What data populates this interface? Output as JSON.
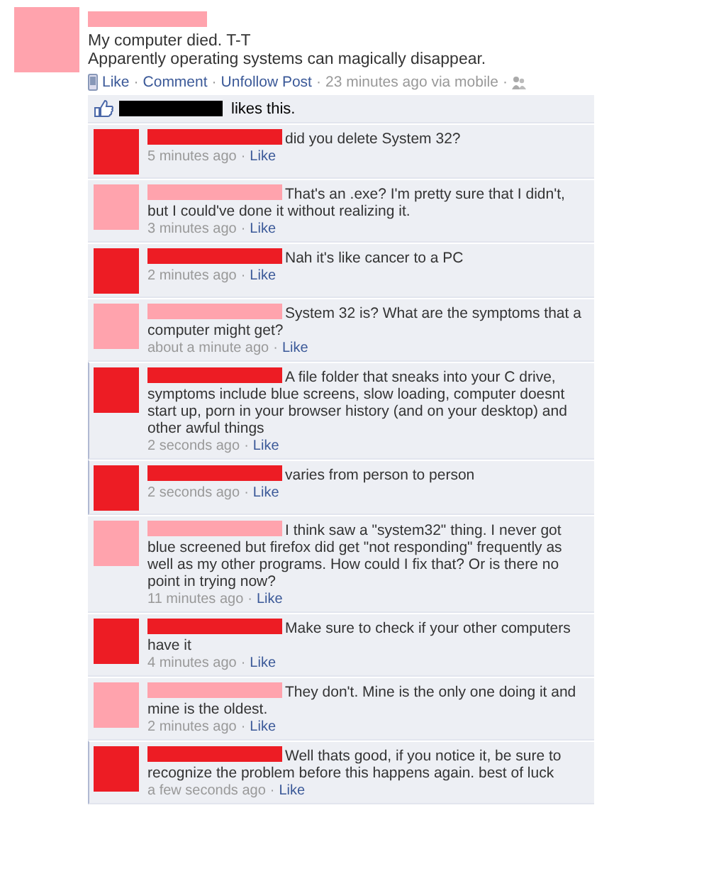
{
  "post": {
    "color": "#ffa3ad",
    "lines": [
      "My computer died. T-T",
      "Apparently operating systems can magically disappear."
    ],
    "actions": [
      "Like",
      "Comment",
      "Unfollow Post"
    ],
    "time": "23 minutes ago via mobile",
    "separator": "·"
  },
  "likes": {
    "text": "likes this."
  },
  "comments": [
    {
      "color": "#ed1c24",
      "unread": false,
      "text": "did you delete System 32?",
      "time": "5 minutes ago",
      "like": "Like"
    },
    {
      "color": "#ffa3ad",
      "unread": false,
      "text": "That's an .exe? I'm pretty sure that I didn't, but I could've done it without realizing it.",
      "time": "3 minutes ago",
      "like": "Like"
    },
    {
      "color": "#ed1c24",
      "unread": false,
      "text": "Nah it's like cancer to a PC",
      "time": "2 minutes ago",
      "like": "Like"
    },
    {
      "color": "#ffa3ad",
      "unread": false,
      "text": "System 32 is? What are the symptoms that a computer might get?",
      "time": "about a minute ago",
      "like": "Like"
    },
    {
      "color": "#ed1c24",
      "unread": true,
      "text": "A file folder that sneaks into your C drive, symptoms include blue screens, slow loading, computer doesnt start up, porn in your browser history (and on your desktop) and other awful things",
      "time": "2 seconds ago",
      "like": "Like"
    },
    {
      "color": "#ed1c24",
      "unread": true,
      "text": "varies from person to person",
      "time": "2 seconds ago",
      "like": "Like"
    },
    {
      "color": "#ffa3ad",
      "unread": false,
      "text": "I think saw a \"system32\" thing. I never got blue screened but firefox did get \"not responding\" frequently as well as my other programs. How could I fix that? Or is there no point in trying now?",
      "time": "11 minutes ago",
      "like": "Like"
    },
    {
      "color": "#ed1c24",
      "unread": false,
      "text": "Make sure to check if your other computers have it",
      "time": "4 minutes ago",
      "like": "Like"
    },
    {
      "color": "#ffa3ad",
      "unread": false,
      "text": "They don't. Mine is the only one doing it and mine is the oldest.",
      "time": "2 minutes ago",
      "like": "Like"
    },
    {
      "color": "#ed1c24",
      "unread": true,
      "text": "Well thats good, if you notice it, be sure to recognize the problem before this happens again. best of luck",
      "time": "a few seconds ago",
      "like": "Like"
    }
  ]
}
